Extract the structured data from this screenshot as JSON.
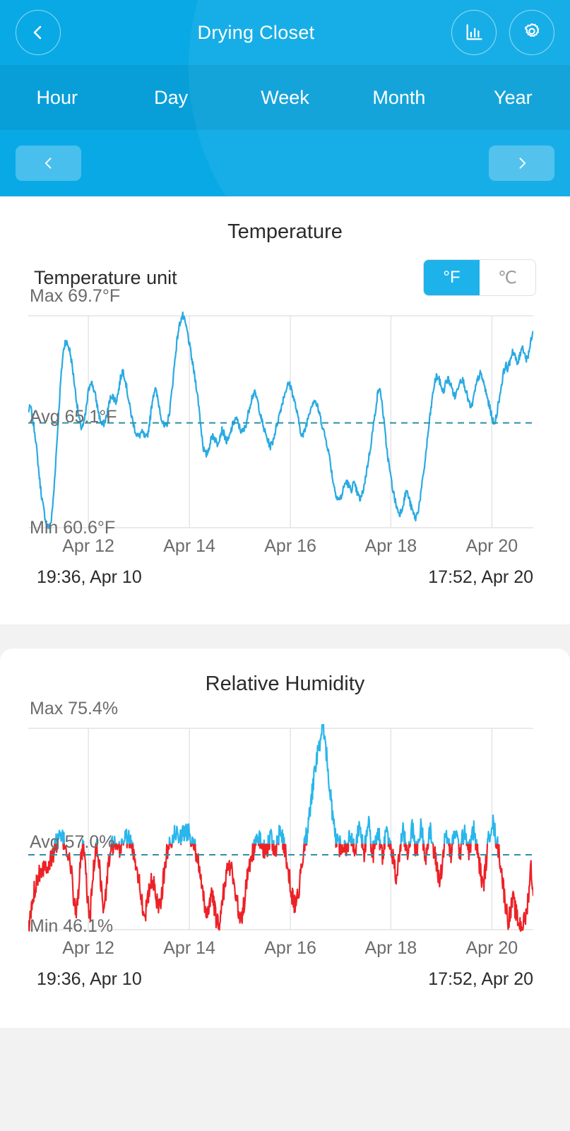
{
  "header": {
    "title": "Drying Closet",
    "back_icon": "chevron-left-icon",
    "stats_icon": "bar-chart-icon",
    "settings_icon": "gear-icon",
    "accent_color": "#09a9e6",
    "tabs": [
      {
        "label": "Hour"
      },
      {
        "label": "Day"
      },
      {
        "label": "Week"
      },
      {
        "label": "Month"
      },
      {
        "label": "Year"
      }
    ],
    "prev_icon": "chevron-left-icon",
    "next_icon": "chevron-right-icon"
  },
  "temperature": {
    "title": "Temperature",
    "unit_label": "Temperature unit",
    "unit_options": [
      {
        "label": "°F",
        "selected": true
      },
      {
        "label": "℃",
        "selected": false
      }
    ],
    "max_label": "Max 69.7°F",
    "avg_label": "Avg 65.1°F",
    "min_label": "Min 60.6°F",
    "start_label": "19:36,  Apr 10",
    "end_label": "17:52,  Apr 20",
    "line_color": "#2aaae1"
  },
  "humidity": {
    "title": "Relative Humidity",
    "max_label": "Max 75.4%",
    "avg_label": "Avg 57.0%",
    "min_label": "Min 46.1%",
    "start_label": "19:36,  Apr 10",
    "end_label": "17:52,  Apr 20",
    "high_color": "#29b6ea",
    "low_color": "#ec2227"
  },
  "chart_data": [
    {
      "type": "line",
      "title": "Temperature",
      "ylabel": "°F",
      "xlabel": "",
      "grid": true,
      "legend": null,
      "ylim": [
        60.6,
        69.7
      ],
      "stats": {
        "max": 69.7,
        "avg": 65.1,
        "min": 60.6,
        "unit": "°F"
      },
      "x_tick_labels": [
        "Apr 12",
        "Apr 14",
        "Apr 16",
        "Apr 18",
        "Apr 20"
      ],
      "x_tick_fracs": [
        0.119,
        0.319,
        0.519,
        0.718,
        0.918
      ],
      "x_range": [
        "19:36, Apr 10",
        "17:52, Apr 20"
      ],
      "avg_line": 65.1,
      "values": [
        65.6,
        65.8,
        65.2,
        64.6,
        63.6,
        62.6,
        61.8,
        61.2,
        60.7,
        60.6,
        60.9,
        62.0,
        63.6,
        65.2,
        66.8,
        68.0,
        68.6,
        68.5,
        68.2,
        67.6,
        66.8,
        66.0,
        65.3,
        64.9,
        65.0,
        65.6,
        66.4,
        66.9,
        66.7,
        66.3,
        65.8,
        65.3,
        65.0,
        65.1,
        65.4,
        65.9,
        66.3,
        66.2,
        66.0,
        66.4,
        67.0,
        67.4,
        67.0,
        66.4,
        65.8,
        65.3,
        64.9,
        64.6,
        64.5,
        64.7,
        64.6,
        64.4,
        64.7,
        65.4,
        66.2,
        66.6,
        66.2,
        65.7,
        65.2,
        64.9,
        65.0,
        65.4,
        66.2,
        67.2,
        68.2,
        69.0,
        69.5,
        69.7,
        69.4,
        69.0,
        68.4,
        67.8,
        67.2,
        66.6,
        65.8,
        64.8,
        64.0,
        63.7,
        63.9,
        64.3,
        64.6,
        64.4,
        64.2,
        64.5,
        64.8,
        64.6,
        64.3,
        64.4,
        64.8,
        65.1,
        65.3,
        65.1,
        64.8,
        64.7,
        64.9,
        65.3,
        65.8,
        66.2,
        66.4,
        66.2,
        65.8,
        65.3,
        64.9,
        64.6,
        64.3,
        64.1,
        64.3,
        64.7,
        65.1,
        65.5,
        65.9,
        66.3,
        66.6,
        66.8,
        66.6,
        66.2,
        65.8,
        65.3,
        64.8,
        64.5,
        64.8,
        65.2,
        65.6,
        65.9,
        66.1,
        65.9,
        65.6,
        65.2,
        64.8,
        64.4,
        64.0,
        63.4,
        62.7,
        62.2,
        61.9,
        61.8,
        62.0,
        62.4,
        62.6,
        62.4,
        62.2,
        62.5,
        62.3,
        62.0,
        61.8,
        62.1,
        62.6,
        63.2,
        63.8,
        64.5,
        65.2,
        66.0,
        66.6,
        66.3,
        65.4,
        64.4,
        63.6,
        62.9,
        62.3,
        61.8,
        61.4,
        61.2,
        61.4,
        61.8,
        62.2,
        61.9,
        61.5,
        61.2,
        61.0,
        61.3,
        61.9,
        62.6,
        63.4,
        64.3,
        65.2,
        66.0,
        66.7,
        67.1,
        67.0,
        66.7,
        66.4,
        66.8,
        67.0,
        66.8,
        66.5,
        66.2,
        66.5,
        66.9,
        67.0,
        66.8,
        66.4,
        66.0,
        65.7,
        66.1,
        66.6,
        67.0,
        67.2,
        67.0,
        66.6,
        66.2,
        65.8,
        65.4,
        65.0,
        65.4,
        66.0,
        66.6,
        67.2,
        67.6,
        67.4,
        67.8,
        68.2,
        68.0,
        67.6,
        67.9,
        68.4,
        68.2,
        67.8,
        68.1,
        68.6,
        69.0
      ]
    },
    {
      "type": "line",
      "title": "Relative Humidity",
      "ylabel": "%",
      "xlabel": "",
      "grid": true,
      "legend": null,
      "ylim": [
        46.1,
        75.4
      ],
      "stats": {
        "max": 75.4,
        "avg": 57.0,
        "min": 46.1,
        "unit": "%"
      },
      "x_tick_labels": [
        "Apr 12",
        "Apr 14",
        "Apr 16",
        "Apr 18",
        "Apr 20"
      ],
      "x_tick_fracs": [
        0.119,
        0.319,
        0.519,
        0.718,
        0.918
      ],
      "x_range": [
        "19:36, Apr 10",
        "17:52, Apr 20"
      ],
      "avg_line": 57.0,
      "split_value": 58.6,
      "values": [
        46.1,
        48.0,
        50.5,
        52.5,
        53.8,
        54.6,
        55.1,
        55.4,
        55.6,
        55.8,
        56.2,
        57.4,
        58.6,
        59.2,
        59.4,
        59.2,
        58.6,
        57.6,
        56.3,
        54.0,
        50.4,
        48.4,
        52.0,
        56.0,
        58.2,
        55.0,
        50.2,
        47.8,
        52.4,
        56.6,
        58.0,
        56.2,
        52.0,
        48.6,
        51.4,
        55.4,
        57.6,
        58.6,
        58.2,
        57.0,
        57.8,
        58.8,
        59.4,
        59.6,
        59.2,
        58.4,
        57.4,
        56.2,
        54.4,
        52.0,
        49.6,
        48.2,
        49.8,
        51.8,
        53.2,
        52.4,
        50.8,
        49.6,
        50.6,
        53.0,
        55.8,
        57.8,
        59.0,
        59.6,
        59.9,
        60.2,
        60.0,
        59.8,
        60.1,
        60.4,
        60.2,
        59.8,
        59.2,
        58.2,
        56.6,
        54.4,
        51.8,
        49.8,
        48.6,
        49.4,
        51.2,
        50.2,
        48.0,
        46.6,
        47.8,
        50.4,
        52.8,
        54.6,
        55.6,
        54.8,
        53.2,
        51.0,
        48.8,
        47.4,
        48.8,
        51.6,
        54.2,
        56.0,
        57.2,
        58.0,
        58.8,
        59.6,
        58.8,
        57.8,
        57.0,
        58.6,
        59.8,
        58.6,
        57.4,
        58.8,
        60.4,
        59.6,
        58.0,
        56.4,
        54.2,
        52.0,
        50.2,
        49.4,
        51.0,
        53.8,
        56.6,
        58.4,
        60.2,
        62.6,
        65.4,
        68.2,
        70.6,
        72.4,
        74.0,
        75.4,
        73.2,
        70.0,
        66.4,
        63.0,
        60.4,
        58.6,
        58.2,
        58.4,
        58.0,
        57.6,
        58.8,
        60.4,
        58.4,
        57.2,
        59.6,
        61.0,
        58.8,
        57.4,
        59.8,
        61.2,
        58.6,
        57.2,
        59.4,
        60.8,
        58.4,
        57.0,
        59.2,
        60.6,
        58.6,
        57.4,
        55.8,
        53.4,
        55.8,
        58.8,
        60.2,
        58.6,
        57.2,
        59.4,
        61.0,
        58.8,
        57.4,
        59.6,
        61.2,
        58.6,
        57.0,
        58.8,
        60.4,
        58.2,
        56.8,
        55.0,
        53.0,
        55.4,
        58.4,
        60.0,
        58.4,
        57.0,
        59.0,
        60.8,
        58.6,
        57.2,
        59.2,
        61.0,
        58.8,
        57.4,
        59.4,
        60.6,
        58.4,
        56.6,
        54.4,
        52.2,
        54.8,
        58.0,
        60.4,
        62.0,
        60.6,
        58.8,
        57.4,
        55.0,
        52.0,
        49.4,
        47.6,
        48.4,
        50.6,
        49.2,
        47.6,
        47.0,
        46.8,
        47.2,
        48.4,
        51.6,
        55.4,
        51.0
      ]
    }
  ]
}
